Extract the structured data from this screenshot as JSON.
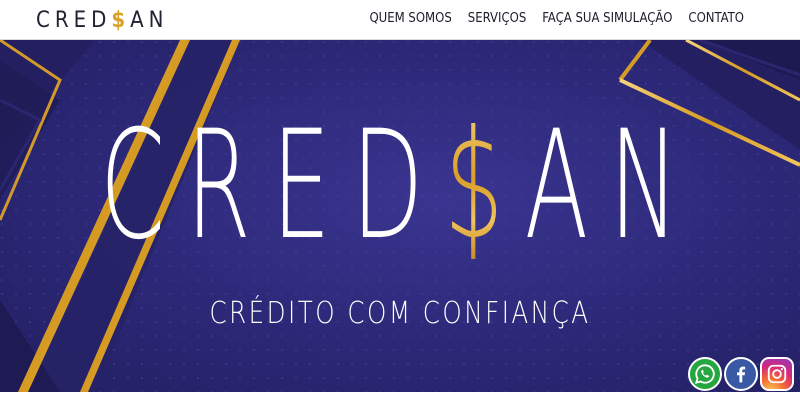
{
  "header": {
    "logo": {
      "part1": "CRED",
      "dollar": "$",
      "part2": "AN"
    },
    "nav": [
      {
        "label": "QUEM SOMOS"
      },
      {
        "label": "SERVIÇOS"
      },
      {
        "label": "FAÇA SUA SIMULAÇÃO"
      },
      {
        "label": "CONTATO"
      }
    ]
  },
  "hero": {
    "brand": {
      "part1": "CRED",
      "dollar": "$",
      "part2": "AN"
    },
    "tagline": "CRÉDITO COM CONFIANÇA"
  },
  "social": [
    {
      "icon": "whatsapp-icon"
    },
    {
      "icon": "facebook-icon"
    },
    {
      "icon": "instagram-icon"
    }
  ],
  "colors": {
    "hero_bg": "#2c2877",
    "gold": "#d8a12b",
    "white": "#ffffff"
  }
}
